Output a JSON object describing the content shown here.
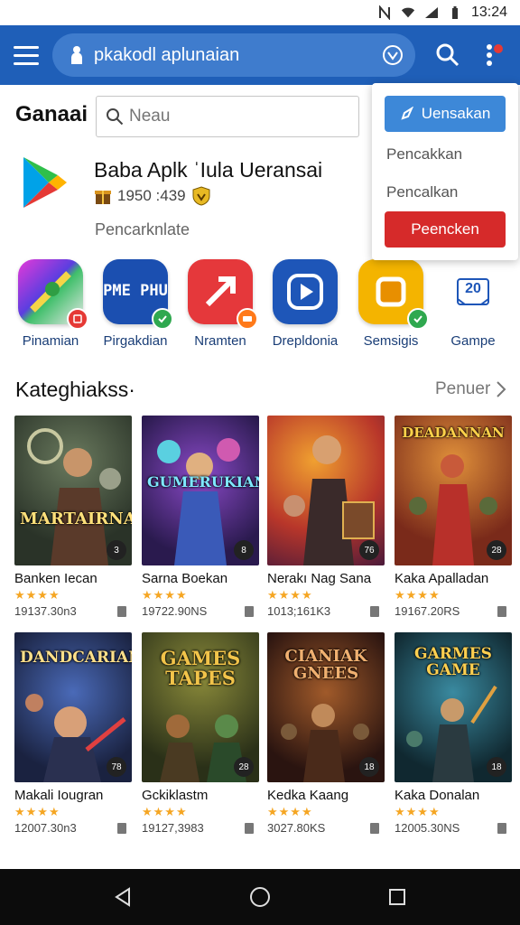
{
  "status": {
    "time": "13:24"
  },
  "appbar": {
    "search_value": "pkakodl aplunaian",
    "accent": "#1f5fb8"
  },
  "dropdown": {
    "primary_label": "Uensakan",
    "items": [
      "Pencakkan",
      "Pencalkan"
    ],
    "danger_label": "Peencken"
  },
  "header": {
    "title": "Ganaai",
    "filter_placeholder": "Neau"
  },
  "featured": {
    "title": "Baba Aplk ˈIula Ueransai",
    "meta": "1950 :439",
    "subtitle": "Pencarknlate"
  },
  "apps": [
    {
      "label": "Pinamian",
      "icon": "map-app-icon",
      "color": "#7a3fd1"
    },
    {
      "label": "Pirgakdian",
      "icon": "text-app-icon",
      "color": "#1b4fb0",
      "tile_text": "PME PHU"
    },
    {
      "label": "Nramten",
      "icon": "arrow-app-icon",
      "color": "#e5383b"
    },
    {
      "label": "Drepldonia",
      "icon": "play-app-icon",
      "color": "#1e56b8"
    },
    {
      "label": "Semsigis",
      "icon": "square-app-icon",
      "color": "#f4b400"
    },
    {
      "label": "Gampe",
      "icon": "calendar-app-icon",
      "color": "#ffffff",
      "tile_text": "20"
    }
  ],
  "section": {
    "title": "Kateghiakss·",
    "more_label": "Penuer"
  },
  "games": [
    {
      "name": "Banken Iecan",
      "stars": "★★★★",
      "meta": "19137.30n3",
      "cover_title": "MARTAIRNA",
      "rating": "3",
      "bg": "#3a4a3e"
    },
    {
      "name": "Sarna Boekan",
      "stars": "★★★★",
      "meta": "19722.90NS",
      "cover_title": "GUMERUKIAN",
      "rating": "8",
      "bg": "#4a2a7a"
    },
    {
      "name": "Nerakı Nag Sana",
      "stars": "★★★★",
      "meta": "1013;161K3",
      "cover_title": "",
      "rating": "76",
      "bg": "#b8562a"
    },
    {
      "name": "Kaka Apalladan",
      "stars": "★★★★",
      "meta": "19167.20RS",
      "cover_title": "DEADANNAN",
      "rating": "28",
      "bg": "#7a2a2a"
    },
    {
      "name": "Makali Iougran",
      "stars": "★★★★",
      "meta": "12007.30n3",
      "cover_title": "DANDCARIAN",
      "rating": "78",
      "bg": "#2a3a5e"
    },
    {
      "name": "Gckiklastm",
      "stars": "★★★★",
      "meta": "19127,3983",
      "cover_title": "GAMES TAPES",
      "rating": "28",
      "bg": "#3e4a22"
    },
    {
      "name": "Kedka Kaang",
      "stars": "★★★★",
      "meta": "3027.80KS",
      "cover_title": "CIANIAK GNEES",
      "rating": "18",
      "bg": "#5a2e1e"
    },
    {
      "name": "Kaka Donalan",
      "stars": "★★★★",
      "meta": "12005.30NS",
      "cover_title": "GARMES GAME",
      "rating": "18",
      "bg": "#1e4a5a"
    }
  ]
}
